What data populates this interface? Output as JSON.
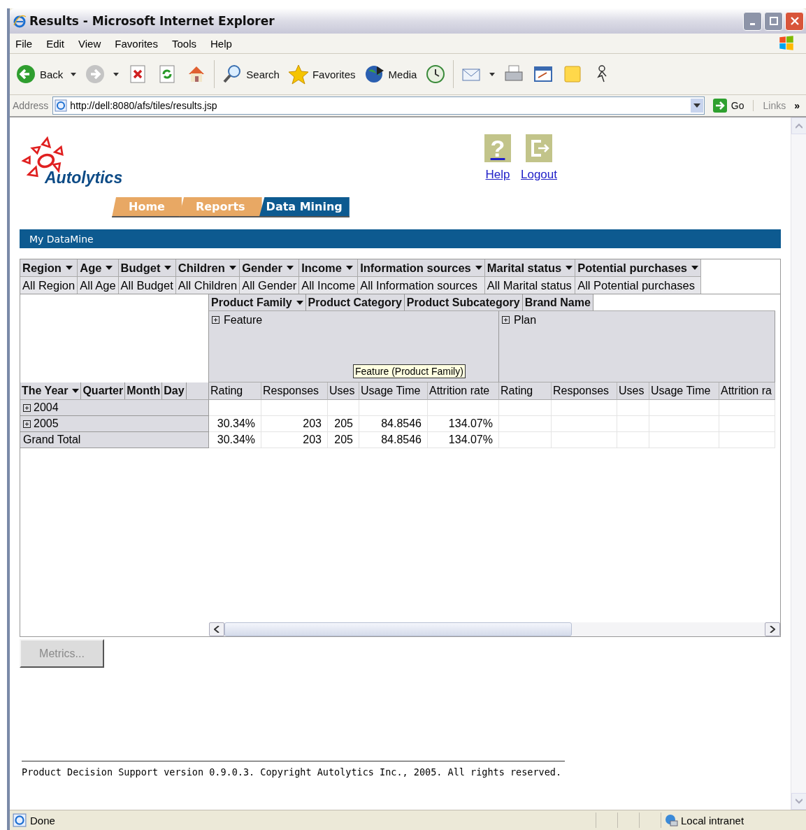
{
  "window": {
    "title": "Results - Microsoft Internet Explorer"
  },
  "menu": [
    "File",
    "Edit",
    "View",
    "Favorites",
    "Tools",
    "Help"
  ],
  "toolbar": [
    [
      {
        "kind": "back",
        "label": "Back",
        "dropdown": true
      },
      {
        "kind": "forward",
        "dropdown": true
      },
      {
        "kind": "stop",
        "dropdown": false
      },
      {
        "kind": "refresh",
        "dropdown": false
      },
      {
        "kind": "home",
        "dropdown": false
      }
    ],
    [
      {
        "kind": "search",
        "label": "Search",
        "dropdown": false
      },
      {
        "kind": "favorites",
        "label": "Favorites",
        "dropdown": false
      },
      {
        "kind": "media",
        "label": "Media",
        "dropdown": false
      },
      {
        "kind": "history",
        "dropdown": false
      }
    ],
    [
      {
        "kind": "mail",
        "dropdown": true
      },
      {
        "kind": "print",
        "dropdown": false
      },
      {
        "kind": "edit",
        "dropdown": false
      },
      {
        "kind": "note",
        "dropdown": false
      },
      {
        "kind": "messenger",
        "dropdown": false
      }
    ]
  ],
  "address": {
    "label": "Address",
    "url": "http://dell:8080/afs/tiles/results.jsp",
    "go": "Go",
    "links": "Links",
    "more": "»"
  },
  "page": {
    "brand": "Autolytics",
    "header_links": [
      {
        "kind": "help",
        "label": "Help",
        "icon_text": "?"
      },
      {
        "kind": "logout",
        "label": "Logout"
      }
    ],
    "tabs": [
      {
        "label": "Home",
        "selected": false
      },
      {
        "label": "Reports",
        "selected": false
      },
      {
        "label": "Data Mining",
        "selected": true
      }
    ],
    "section_title": "My DataMine",
    "filters": [
      {
        "field": "Region",
        "value": "All Region"
      },
      {
        "field": "Age",
        "value": "All Age"
      },
      {
        "field": "Budget",
        "value": "All Budget"
      },
      {
        "field": "Children",
        "value": "All Children"
      },
      {
        "field": "Gender",
        "value": "All Gender"
      },
      {
        "field": "Income",
        "value": "All Income"
      },
      {
        "field": "Information sources",
        "value": "All Information sources"
      },
      {
        "field": "Marital status",
        "value": "All Marital status"
      },
      {
        "field": "Potential purchases",
        "value": "All Potential purchases"
      }
    ],
    "pivot": {
      "column_fields": [
        {
          "label": "Product Family",
          "menu": true
        },
        {
          "label": "Product Category",
          "menu": false
        },
        {
          "label": "Product Subcategory",
          "menu": false
        },
        {
          "label": "Brand Name",
          "menu": false
        }
      ],
      "row_fields": [
        {
          "label": "The Year",
          "menu": true
        },
        {
          "label": "Quarter",
          "menu": false
        },
        {
          "label": "Month",
          "menu": false
        },
        {
          "label": "Day",
          "menu": false
        }
      ],
      "column_groups": [
        {
          "label": "Feature",
          "expandable": true
        },
        {
          "label": "Plan",
          "expandable": true
        }
      ],
      "measures": [
        "Rating",
        "Responses",
        "Uses",
        "Usage Time",
        "Attrition rate",
        "Rating",
        "Responses",
        "Uses",
        "Usage Time",
        "Attrition ra"
      ],
      "rows": [
        {
          "label": "2004",
          "expandable": true
        },
        {
          "label": "2005",
          "expandable": true,
          "values": [
            "30.34%",
            "203",
            "205",
            "84.8546",
            "134.07%"
          ]
        },
        {
          "label": "Grand Total",
          "expandable": false,
          "values": [
            "30.34%",
            "203",
            "205",
            "84.8546",
            "134.07%"
          ]
        }
      ],
      "tooltip": "Feature (Product Family)"
    },
    "metrics_button": {
      "label": "Metrics...",
      "disabled": true
    },
    "footer": "Product Decision Support version 0.9.0.3. Copyright Autolytics Inc., 2005. All rights reserved."
  },
  "status_bar": {
    "text": "Done",
    "zone": "Local intranet"
  }
}
